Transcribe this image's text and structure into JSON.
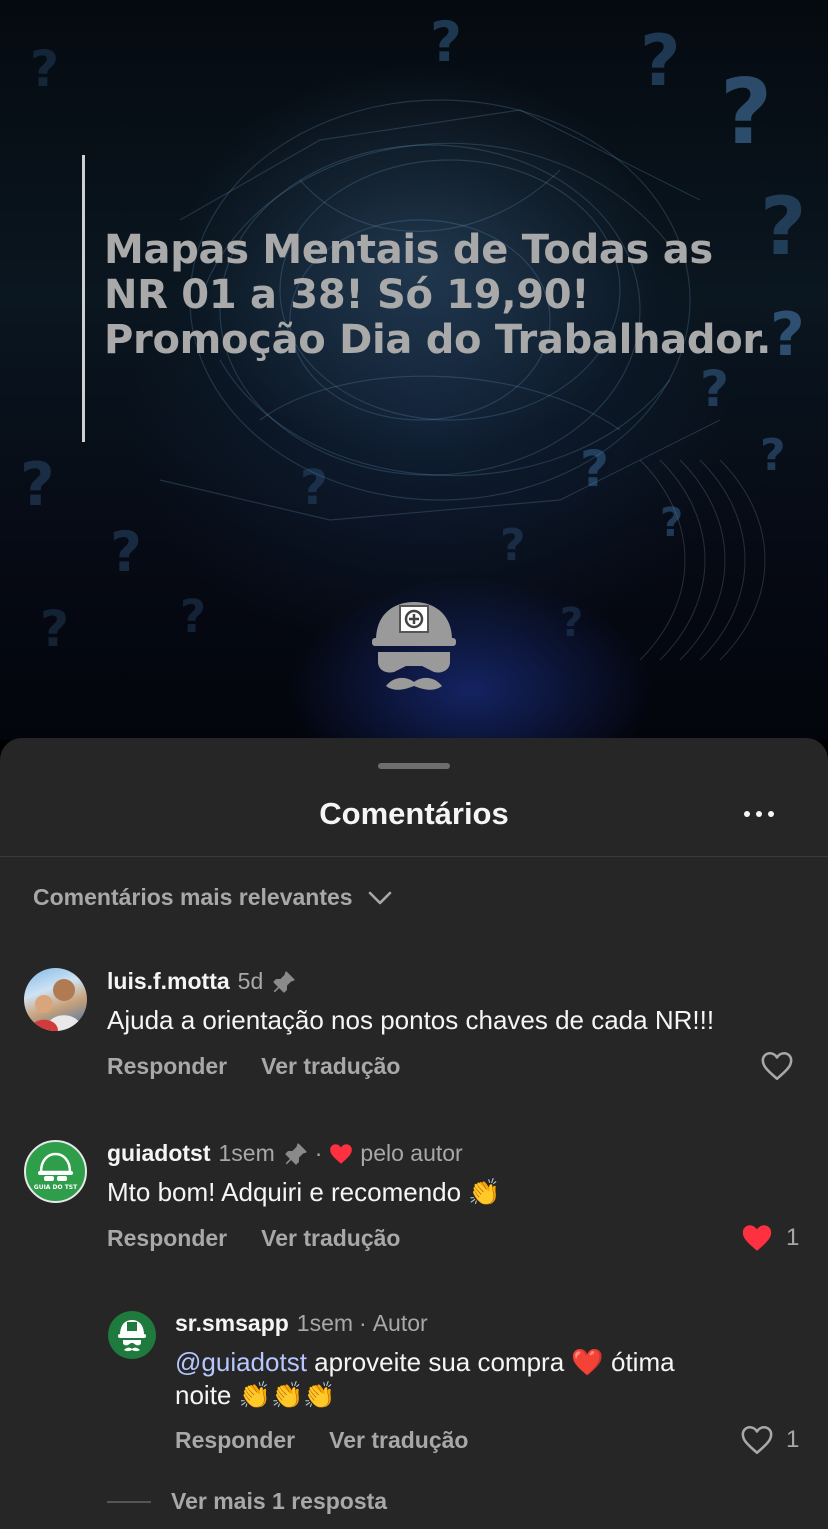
{
  "post": {
    "headline_lines": [
      "Mapas Mentais de Todas as",
      "NR 01 a 38! Só 19,90!",
      "Promoção Dia do Trabalhador."
    ]
  },
  "sheet": {
    "title": "Comentários",
    "sort_label": "Comentários mais relevantes"
  },
  "comments": [
    {
      "username": "luis.f.motta",
      "time": "5d",
      "text": "Ajuda a orientação nos pontos chaves de cada NR!!!",
      "reply_label": "Responder",
      "translate_label": "Ver tradução",
      "liked": false,
      "likes": ""
    },
    {
      "username": "guiadotst",
      "time": "1sem",
      "author_like_label": "pelo autor",
      "avatar_text": "GUIA DO TST",
      "text": "Mto bom! Adquiri e recomendo 👏",
      "reply_label": "Responder",
      "translate_label": "Ver tradução",
      "liked": true,
      "likes": "1"
    },
    {
      "username": "sr.smsapp",
      "time": "1sem",
      "badge": "Autor",
      "mention": "@guiadotst",
      "text_line1": " aproveite sua compra ❤️ ótima",
      "text_line2": "noite 👏👏👏",
      "reply_label": "Responder",
      "translate_label": "Ver tradução",
      "liked": false,
      "likes": "1"
    }
  ],
  "more_replies_label": "Ver mais 1 resposta",
  "colors": {
    "sheet_bg": "#262626",
    "like_red": "#ff3040",
    "mention": "#b6c6ff",
    "brand_green": "#2e9e4a"
  },
  "icons": [
    "pin-icon",
    "heart-icon",
    "heart-filled-icon",
    "chevron-down-icon",
    "more-icon",
    "clap-emoji"
  ]
}
